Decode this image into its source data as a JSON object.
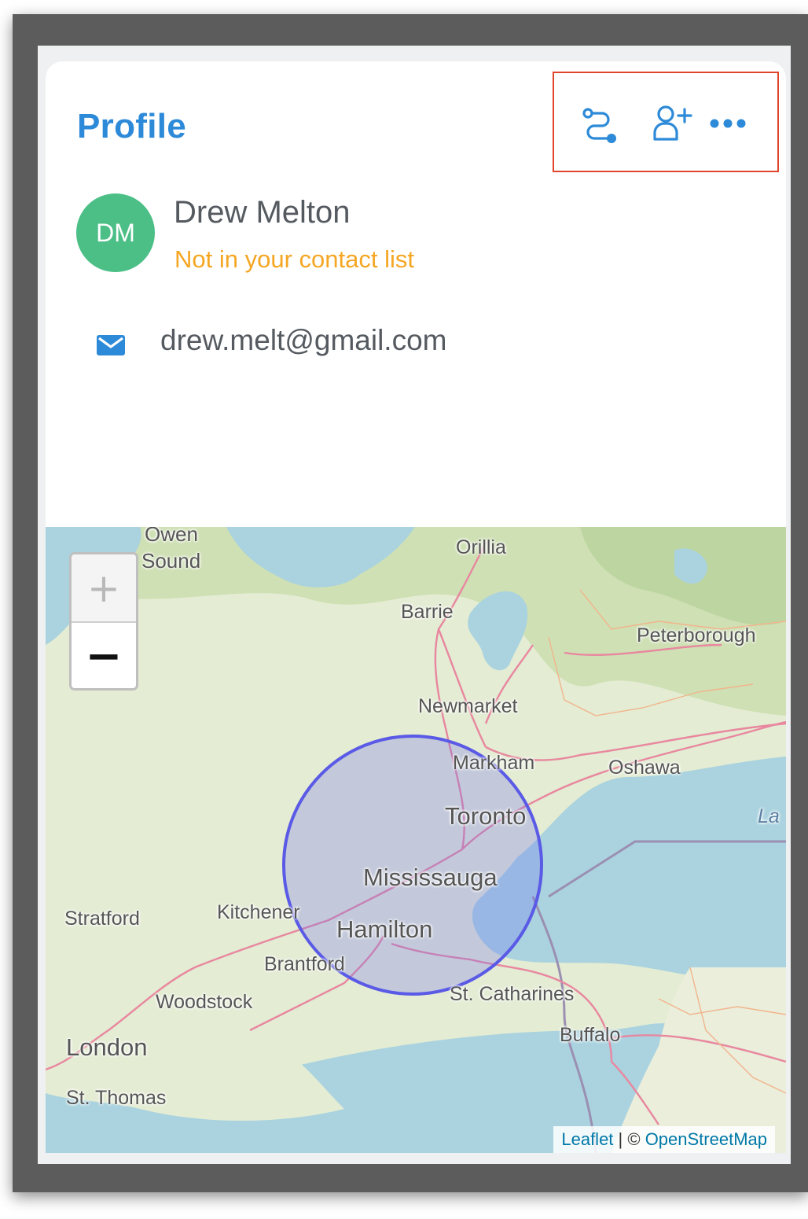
{
  "card": {
    "title": "Profile"
  },
  "toolbar": {
    "route_icon": "route-icon",
    "add_contact_icon": "add-person-icon",
    "more_icon": "more-dots-icon"
  },
  "contact": {
    "initials": "DM",
    "name": "Drew Melton",
    "status": "Not in your contact list",
    "email": "drew.melt@gmail.com",
    "email_icon": "envelope-icon"
  },
  "map": {
    "zoom_in_label": "+",
    "zoom_out_label": "−",
    "attribution_leaflet": "Leaflet",
    "attribution_separator": " | © ",
    "attribution_osm": "OpenStreetMap",
    "cities": {
      "owen": "Owen",
      "sound": "Sound",
      "orillia": "Orillia",
      "barrie": "Barrie",
      "peterborough": "Peterborough",
      "newmarket": "Newmarket",
      "markham": "Markham",
      "oshawa": "Oshawa",
      "toronto": "Toronto",
      "lake": "La",
      "mississauga": "Mississauga",
      "stratford": "Stratford",
      "kitchener": "Kitchener",
      "hamilton": "Hamilton",
      "brantford": "Brantford",
      "st_catharines": "St. Catharines",
      "woodstock": "Woodstock",
      "buffalo": "Buffalo",
      "london": "London",
      "st_thomas": "St. Thomas"
    }
  },
  "colors": {
    "accent": "#2d8ad8",
    "avatar": "#4cbf87",
    "status": "#f5a623",
    "highlight": "#e0452b",
    "radius_circle": "#5a5ae6"
  }
}
